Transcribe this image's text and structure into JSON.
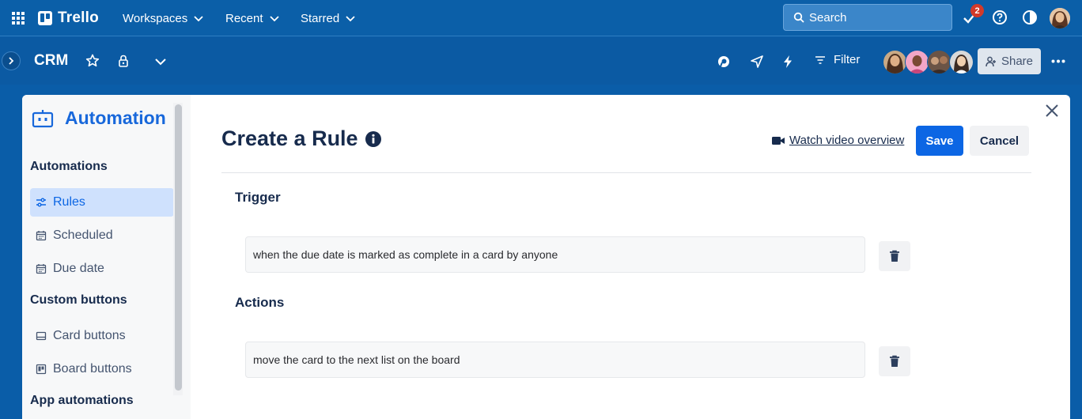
{
  "topbar": {
    "logo": "Trello",
    "menus": [
      "Workspaces",
      "Recent",
      "Starred"
    ],
    "search_label": "Search",
    "notification_count": "2"
  },
  "boardbar": {
    "title": "CRM",
    "filter_label": "Filter",
    "share_label": "Share"
  },
  "sidebar": {
    "title": "Automation",
    "section_automations": "Automations",
    "items_automations": [
      "Rules",
      "Scheduled",
      "Due date"
    ],
    "section_custom": "Custom buttons",
    "items_custom": [
      "Card buttons",
      "Board buttons"
    ],
    "section_app": "App automations"
  },
  "main": {
    "title": "Create a Rule",
    "video_link": "Watch video overview",
    "save_label": "Save",
    "cancel_label": "Cancel",
    "trigger_heading": "Trigger",
    "trigger_text": "when the due date is marked as complete in a card by anyone",
    "actions_heading": "Actions",
    "action_text": "move the card to the next list on the board"
  },
  "colors": {
    "brand_blue": "#0b5fa8",
    "accent": "#0c66e4",
    "badge_red": "#d23a2a"
  }
}
